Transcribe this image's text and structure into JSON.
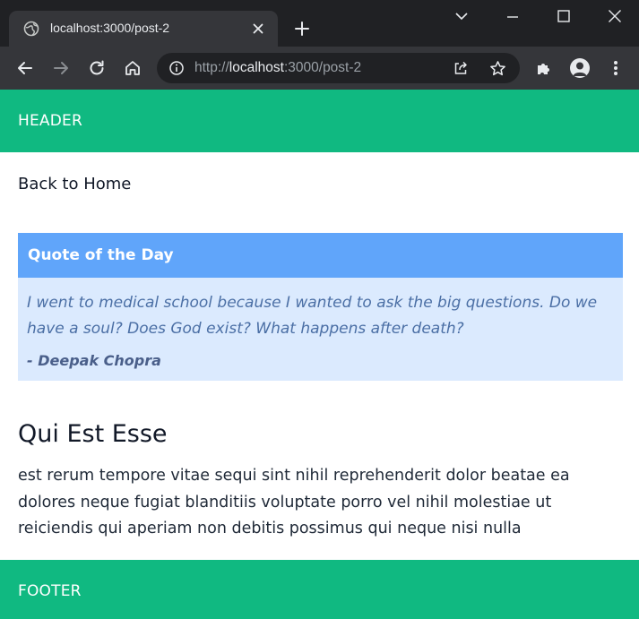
{
  "browser": {
    "tab": {
      "title": "localhost:3000/post-2",
      "favicon": "globe-icon"
    },
    "address_bar": {
      "scheme": "http://",
      "host": "localhost",
      "port_path": ":3000/post-2"
    },
    "colors": {
      "titlebar": "#202124",
      "toolbar": "#35363a",
      "omnibox": "#202124",
      "text": "#e8eaed"
    }
  },
  "page": {
    "header": {
      "label": "HEADER"
    },
    "nav": {
      "back_link": "Back to Home"
    },
    "quote": {
      "heading": "Quote of the Day",
      "text": "I went to medical school because I wanted to ask the big questions. Do we have a soul? Does God exist? What happens after death?",
      "author": "- Deepak Chopra"
    },
    "post": {
      "title": "Qui Est Esse",
      "body": "est rerum tempore vitae sequi sint nihil reprehenderit dolor beatae ea dolores neque fugiat blanditiis voluptate porro vel nihil molestiae ut reiciendis qui aperiam non debitis possimus qui neque nisi nulla"
    },
    "footer": {
      "label": "FOOTER"
    },
    "colors": {
      "header_footer": "#10b981",
      "quote_header": "#60a5fa",
      "quote_body": "#dbeafe"
    }
  }
}
